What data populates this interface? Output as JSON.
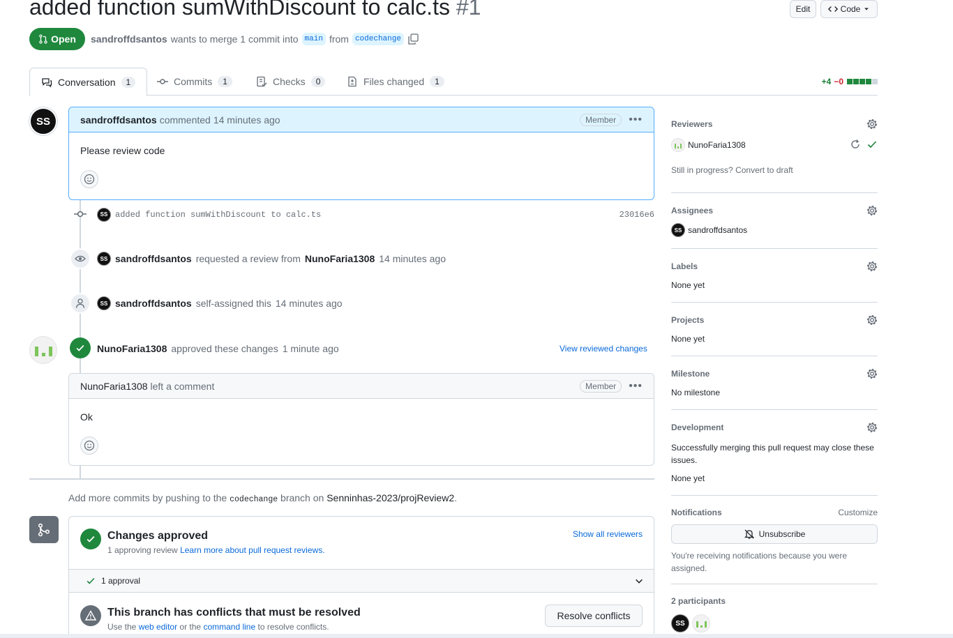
{
  "header": {
    "title": "added function sumWithDiscount to calc.ts",
    "number": "#1",
    "edit_label": "Edit",
    "code_label": "Code",
    "state": "Open",
    "author": "sandroffdsantos",
    "merge_text": "wants to merge 1 commit into",
    "base_branch": "main",
    "from_text": "from",
    "head_branch": "codechange"
  },
  "tabs": [
    {
      "label": "Conversation",
      "count": "1"
    },
    {
      "label": "Commits",
      "count": "1"
    },
    {
      "label": "Checks",
      "count": "0"
    },
    {
      "label": "Files changed",
      "count": "1"
    }
  ],
  "diffstat": {
    "additions": "+4",
    "deletions": "−0",
    "blocks": [
      "green",
      "green",
      "green",
      "green",
      "grey"
    ]
  },
  "timeline": {
    "first_comment": {
      "author": "sandroffdsantos",
      "action": "commented",
      "time": "14 minutes ago",
      "role": "Member",
      "body": "Please review code"
    },
    "commit": {
      "message": "added function sumWithDiscount to calc.ts",
      "sha": "23016e6"
    },
    "review_request": {
      "actor": "sandroffdsantos",
      "text": "requested a review from",
      "reviewer": "NunoFaria1308",
      "time": "14 minutes ago"
    },
    "self_assign": {
      "actor": "sandroffdsantos",
      "text": "self-assigned this",
      "time": "14 minutes ago"
    },
    "approval": {
      "actor": "NunoFaria1308",
      "text": "approved these changes",
      "time": "1 minute ago",
      "link": "View reviewed changes"
    },
    "review_comment": {
      "author": "NunoFaria1308",
      "action": "left a comment",
      "role": "Member",
      "body": "Ok"
    }
  },
  "push_hint": {
    "prefix": "Add more commits by pushing to the",
    "branch": "codechange",
    "middle": "branch on",
    "repo": "Senninhas-2023/projReview2",
    "suffix": "."
  },
  "merge_box": {
    "approved_title": "Changes approved",
    "approved_sub": "1 approving review",
    "approved_link": "Learn more about pull request reviews.",
    "show_reviewers": "Show all reviewers",
    "approval_count": "1 approval",
    "conflict_title": "This branch has conflicts that must be resolved",
    "conflict_prefix": "Use the",
    "conflict_link1": "web editor",
    "conflict_mid": "or the",
    "conflict_link2": "command line",
    "conflict_suffix": "to resolve conflicts.",
    "resolve_button": "Resolve conflicts"
  },
  "sidebar": {
    "reviewers": {
      "title": "Reviewers",
      "name": "NunoFaria1308",
      "progress_prefix": "Still in progress?",
      "progress_link": "Convert to draft"
    },
    "assignees": {
      "title": "Assignees",
      "name": "sandroffdsantos"
    },
    "labels": {
      "title": "Labels",
      "value": "None yet"
    },
    "projects": {
      "title": "Projects",
      "value": "None yet"
    },
    "milestone": {
      "title": "Milestone",
      "value": "No milestone"
    },
    "development": {
      "title": "Development",
      "desc": "Successfully merging this pull request may close these issues.",
      "value": "None yet"
    },
    "notifications": {
      "title": "Notifications",
      "customize": "Customize",
      "button": "Unsubscribe",
      "desc": "You're receiving notifications because you were assigned."
    },
    "participants": {
      "title": "2 participants"
    }
  },
  "avatar_text": "SS",
  "colors": {
    "open_green": "#1f883d",
    "link_blue": "#0969da",
    "avatar_green": "#7dc45a"
  }
}
